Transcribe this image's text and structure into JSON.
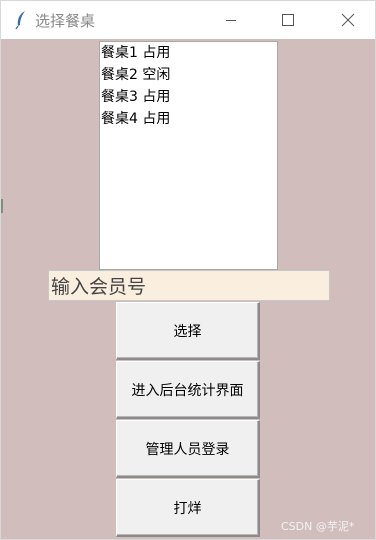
{
  "window": {
    "title": "选择餐桌",
    "icons": {
      "app": "feather-icon",
      "minimize": "minimize-icon",
      "maximize": "maximize-icon",
      "close": "close-icon"
    }
  },
  "listbox": {
    "items": [
      "餐桌1 占用",
      "餐桌2 空闲",
      "餐桌3 占用",
      "餐桌4 占用"
    ]
  },
  "member_input": {
    "value": "输入会员号"
  },
  "buttons": {
    "select": "选择",
    "stats": "进入后台统计界面",
    "admin_login": "管理人员登录",
    "close_shop": "打烊"
  },
  "watermark": "CSDN @芋泥*",
  "colors": {
    "window_bg": "#d0bdbc",
    "input_bg": "#faeedf",
    "button_bg": "#f0f0f0"
  }
}
